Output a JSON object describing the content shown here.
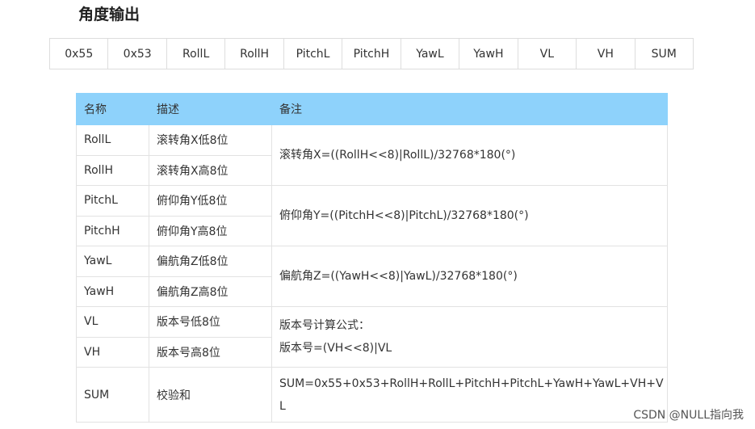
{
  "heading": "角度输出",
  "frame_bytes": [
    "0x55",
    "0x53",
    "RollL",
    "RollH",
    "PitchL",
    "PitchH",
    "YawL",
    "YawH",
    "VL",
    "VH",
    "SUM"
  ],
  "table": {
    "headers": [
      "名称",
      "描述",
      "备注"
    ],
    "rows": [
      {
        "name": "RollL",
        "desc": "滚转角X低8位"
      },
      {
        "name": "RollH",
        "desc": "滚转角X高8位"
      },
      {
        "name": "PitchL",
        "desc": "俯仰角Y低8位"
      },
      {
        "name": "PitchH",
        "desc": "俯仰角Y高8位"
      },
      {
        "name": "YawL",
        "desc": "偏航角Z低8位"
      },
      {
        "name": "YawH",
        "desc": "偏航角Z高8位"
      },
      {
        "name": "VL",
        "desc": "版本号低8位"
      },
      {
        "name": "VH",
        "desc": "版本号高8位"
      },
      {
        "name": "SUM",
        "desc": "校验和"
      }
    ],
    "notes": [
      [
        "滚转角X=((RollH<<8)|RollL)/32768*180(°)"
      ],
      [
        "俯仰角Y=((PitchH<<8)|PitchL)/32768*180(°)"
      ],
      [
        "偏航角Z=((YawH<<8)|YawL)/32768*180(°)"
      ],
      [
        "版本号计算公式：",
        "版本号=(VH<<8)|VL"
      ],
      [
        "SUM=0x55+0x53+RollH+RollL+PitchH+PitchL+YawH+YawL+VH+V",
        "L"
      ]
    ]
  },
  "watermark": "CSDN @NULL指向我"
}
